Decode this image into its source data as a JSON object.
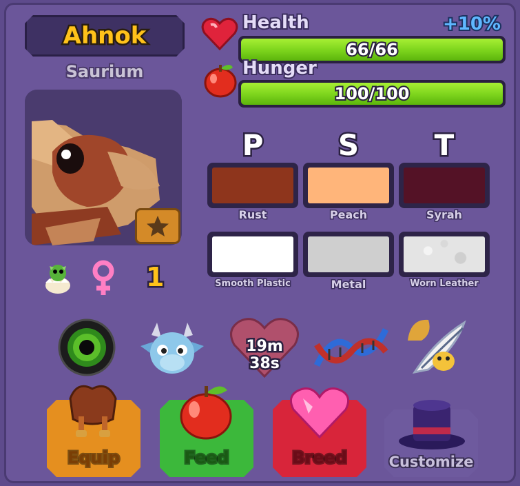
{
  "pet": {
    "name": "Ahnok",
    "species": "Saurium",
    "level": "1"
  },
  "stats": {
    "health_label": "Health",
    "health_bonus": "+10%",
    "health_value": "66/66",
    "health_fraction": 1.0,
    "hunger_label": "Hunger",
    "hunger_value": "100/100",
    "hunger_fraction": 1.0
  },
  "colors": {
    "headers": [
      "P",
      "S",
      "T"
    ],
    "primary": {
      "name": "Rust",
      "hex": "#8e351c"
    },
    "secondary": {
      "name": "Peach",
      "hex": "#ffb57a"
    },
    "tertiary": {
      "name": "Syrah",
      "hex": "#541226"
    }
  },
  "materials": {
    "primary": {
      "name": "Smooth Plastic",
      "hex": "#ffffff"
    },
    "secondary": {
      "name": "Metal",
      "hex": "#cfcfcf"
    },
    "tertiary": {
      "name": "Worn Leather",
      "hex": "#e4e4e4"
    }
  },
  "traits": {
    "breed_timer": "19m 38s",
    "icons": [
      "eye-icon",
      "dragon-head-icon",
      "heart-timer-icon",
      "dna-icon",
      "feather-hat-icon"
    ]
  },
  "actions": {
    "equip": {
      "label": "Equip",
      "color": "#e58f1f"
    },
    "feed": {
      "label": "Feed",
      "color": "#3cb83b"
    },
    "breed": {
      "label": "Breed",
      "color": "#d8253a"
    },
    "customize": {
      "label": "Customize",
      "color": "#6e5a9e"
    }
  },
  "meta_icons": [
    "egg-dragon-icon",
    "female-icon"
  ]
}
